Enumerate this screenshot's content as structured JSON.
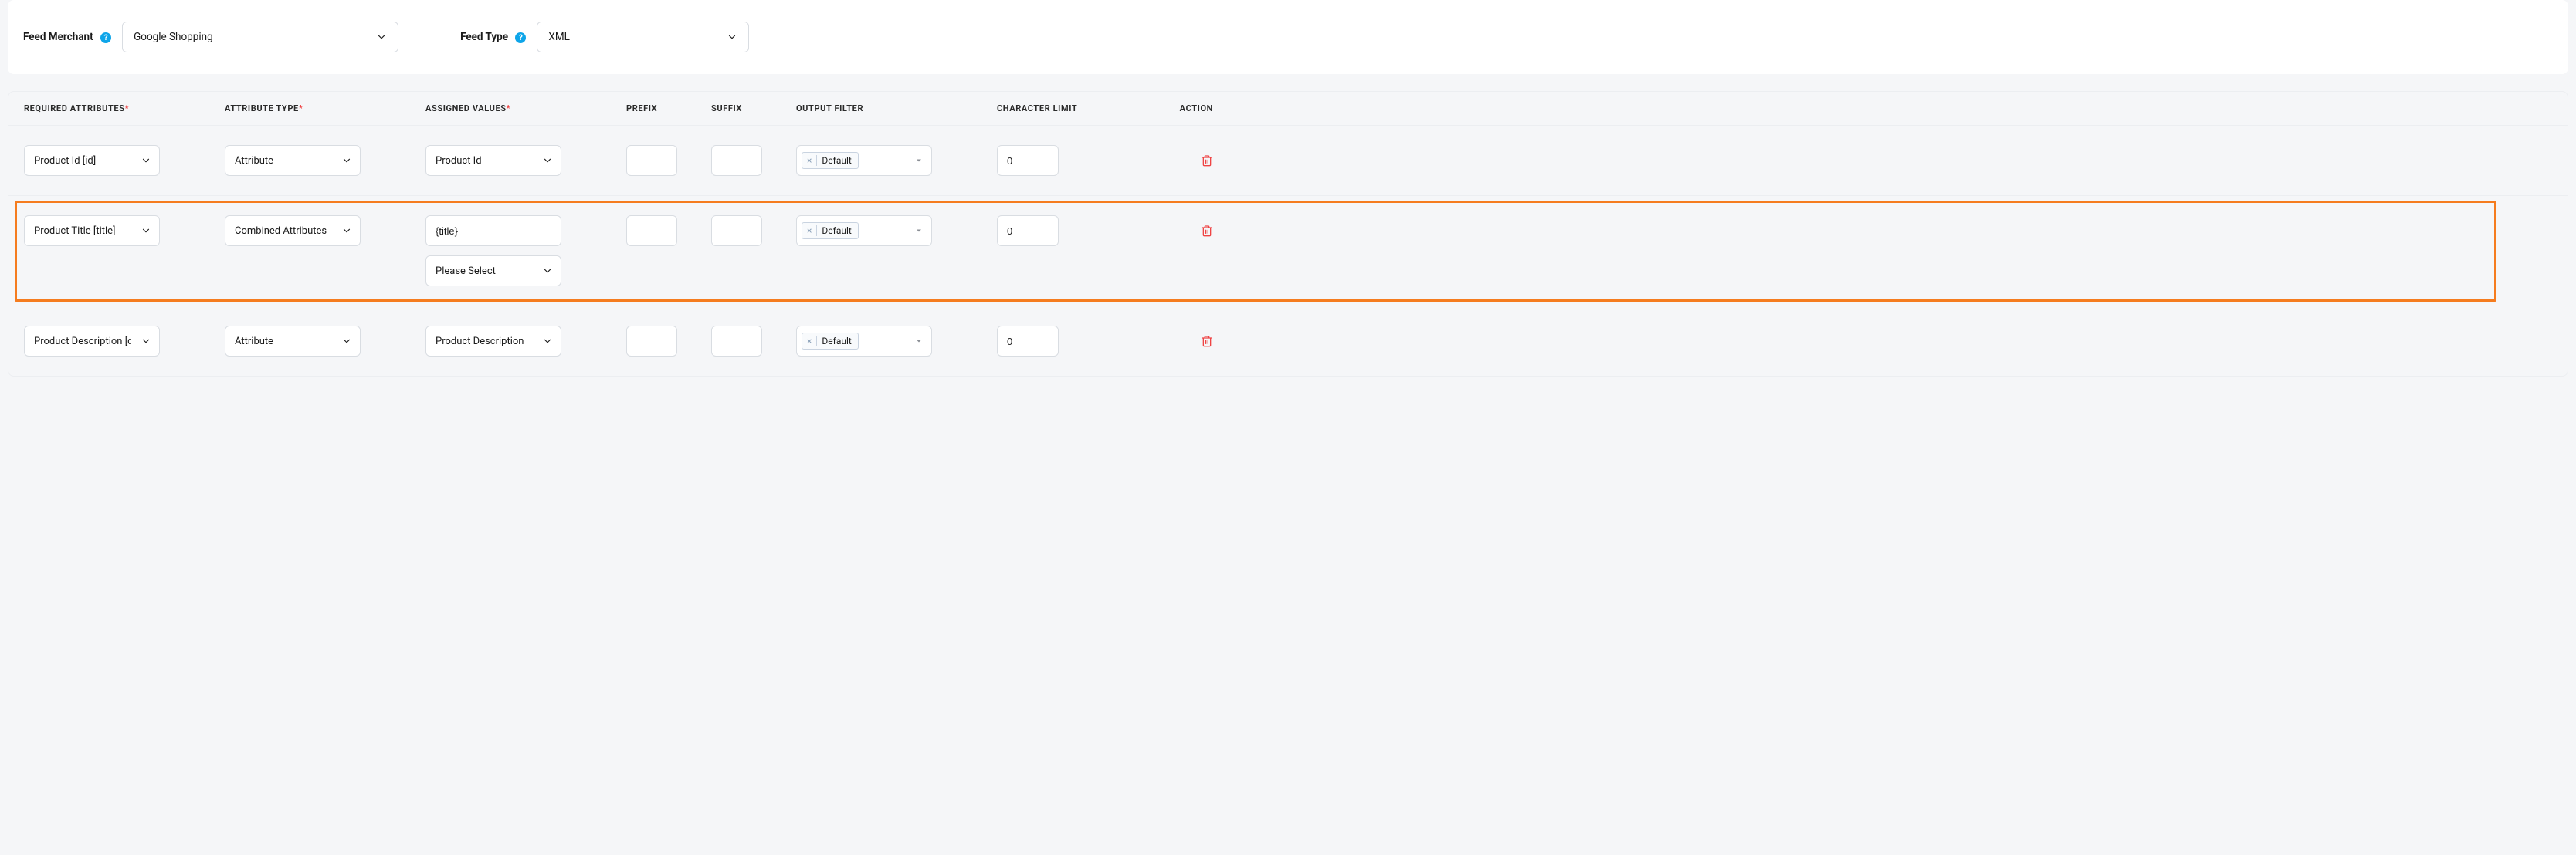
{
  "top": {
    "merchant_label": "Feed Merchant",
    "merchant_value": "Google Shopping",
    "type_label": "Feed Type",
    "type_value": "XML"
  },
  "headers": {
    "required_attributes": "REQUIRED ATTRIBUTES",
    "attribute_type": "ATTRIBUTE TYPE",
    "assigned_values": "ASSIGNED VALUES",
    "prefix": "PREFIX",
    "suffix": "SUFFIX",
    "output_filter": "OUTPUT FILTER",
    "character_limit": "CHARACTER LIMIT",
    "action": "ACTION",
    "required_marker": "*"
  },
  "output_filter_tag": "Default",
  "please_select": "Please Select",
  "rows": [
    {
      "required": "Product Id [id]",
      "type": "Attribute",
      "assigned": "Product Id",
      "prefix": "",
      "suffix": "",
      "char_limit": "0"
    },
    {
      "required": "Product Title [title]",
      "type": "Combined Attributes",
      "assigned_text": "{title}",
      "prefix": "",
      "suffix": "",
      "char_limit": "0"
    },
    {
      "required": "Product Description [description]",
      "type": "Attribute",
      "assigned": "Product Description",
      "prefix": "",
      "suffix": "",
      "char_limit": "0"
    }
  ]
}
